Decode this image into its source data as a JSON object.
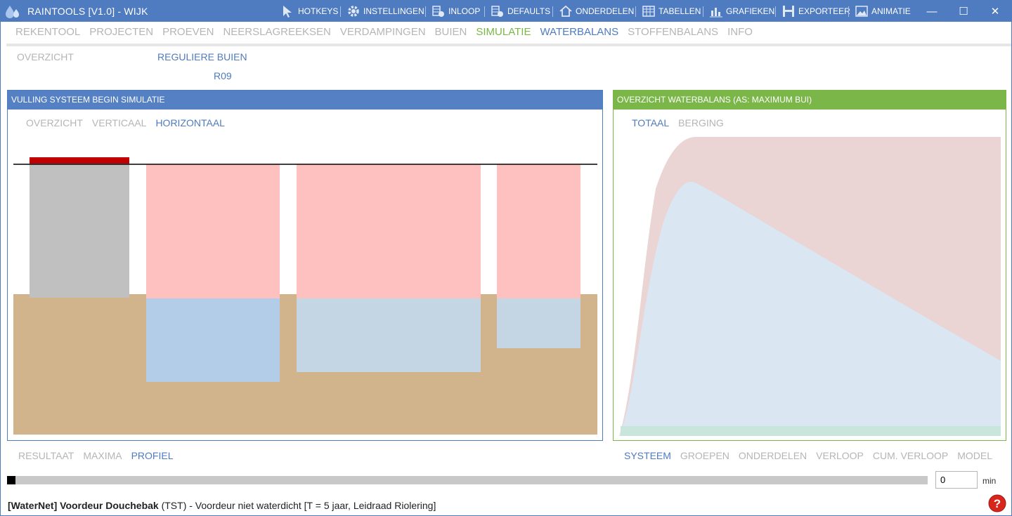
{
  "window": {
    "title": "RAINTOOLS [V1.0] - WIJK",
    "toolbar": [
      {
        "label": "HOTKEYS",
        "icon": "cursor-icon"
      },
      {
        "label": "INSTELLINGEN",
        "icon": "gear-icon"
      },
      {
        "label": "INLOOP",
        "icon": "grid-gear-icon"
      },
      {
        "label": "DEFAULTS",
        "icon": "grid-gear-icon"
      },
      {
        "label": "ONDERDELEN",
        "icon": "house-icon"
      },
      {
        "label": "TABELLEN",
        "icon": "table-icon"
      },
      {
        "label": "GRAFIEKEN",
        "icon": "bar-chart-icon"
      },
      {
        "label": "EXPORTEER",
        "icon": "save-icon"
      },
      {
        "label": "ANIMATIE",
        "icon": "image-icon"
      }
    ],
    "controls": {
      "minimize": "—",
      "maximize": "☐",
      "close": "✕"
    }
  },
  "main_menu": [
    "REKENTOOL",
    "PROJECTEN",
    "PROEVEN",
    "NEERSLAGREEKSEN",
    "VERDAMPINGEN",
    "BUIEN",
    "SIMULATIE",
    "WATERBALANS",
    "STOFFENBALANS",
    "INFO"
  ],
  "sub_nav": {
    "overzicht": "OVERZICHT",
    "reguliere": "REGULIERE BUIEN",
    "bui": "R09"
  },
  "left_panel": {
    "title": "VULLING SYSTEEM BEGIN SIMULATIE",
    "tabs": [
      "OVERZICHT",
      "VERTICAAL",
      "HORIZONTAAL"
    ],
    "active_tab": "HORIZONTAAL"
  },
  "right_panel": {
    "title": "OVERZICHT WATERBALANS  (AS: MAXIMUM BUI)",
    "tabs": [
      "TOTAAL",
      "BERGING"
    ],
    "active_tab": "TOTAAL"
  },
  "bottom_left_tabs": [
    "RESULTAAT",
    "MAXIMA",
    "PROFIEL"
  ],
  "bottom_left_active": "PROFIEL",
  "bottom_right_tabs": [
    "SYSTEEM",
    "GROEPEN",
    "ONDERDELEN",
    "VERLOOP",
    "CUM. VERLOOP",
    "MODEL"
  ],
  "bottom_right_active": "SYSTEEM",
  "time": {
    "value": "0",
    "unit": "min"
  },
  "status": {
    "prefix": "[WaterNet] Voordeur Douchebak",
    "code": "(TST)",
    "description": "- Voordeur niet waterdicht [T = 5 jaar, Leidraad Riolering]"
  },
  "colors": {
    "blue": "#4f7bbf",
    "green": "#7ab648",
    "ground": "#d2b48c",
    "pink": "#ffc0c0",
    "water": "#b3cde8",
    "roof": "#c00000",
    "grey": "#c0c0c0"
  }
}
